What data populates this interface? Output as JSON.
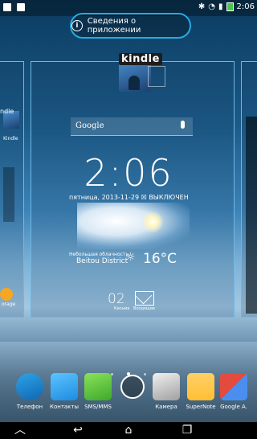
{
  "status_bar": {
    "time": "2:06"
  },
  "app_info": {
    "label": "Сведения о приложении"
  },
  "kindle_word": "kindle",
  "left_panel": {
    "kindle_word": "ndle",
    "kindle_label": "Kindle",
    "storage_label": "orage"
  },
  "google_search": {
    "label": "Google"
  },
  "clock_widget": {
    "time": "2:06",
    "date_line": "пятница, 2013-11-29 ☒ ВЫКЛЮЧЕН",
    "condition": "Небольшая облачность",
    "city": "Beitou District",
    "temperature": "16°C"
  },
  "messages_widget": {
    "count": "02",
    "label_left": "Кисьма",
    "label_right": "Входящие"
  },
  "page_indicator": {
    "count": 5,
    "active_index": 2
  },
  "dock": {
    "apps": [
      {
        "label": "Телефон",
        "icon": "phone-icon"
      },
      {
        "label": "Контакты",
        "icon": "contacts-icon"
      },
      {
        "label": "SMS/MMS",
        "icon": "sms-icon"
      },
      {
        "label": "",
        "icon": "all-apps-icon"
      },
      {
        "label": "Камера",
        "icon": "camera-icon"
      },
      {
        "label": "SuperNote",
        "icon": "supernote-icon"
      },
      {
        "label": "Google A.",
        "icon": "google-apps-icon"
      }
    ]
  },
  "colors": {
    "accent": "#29a9e1"
  }
}
